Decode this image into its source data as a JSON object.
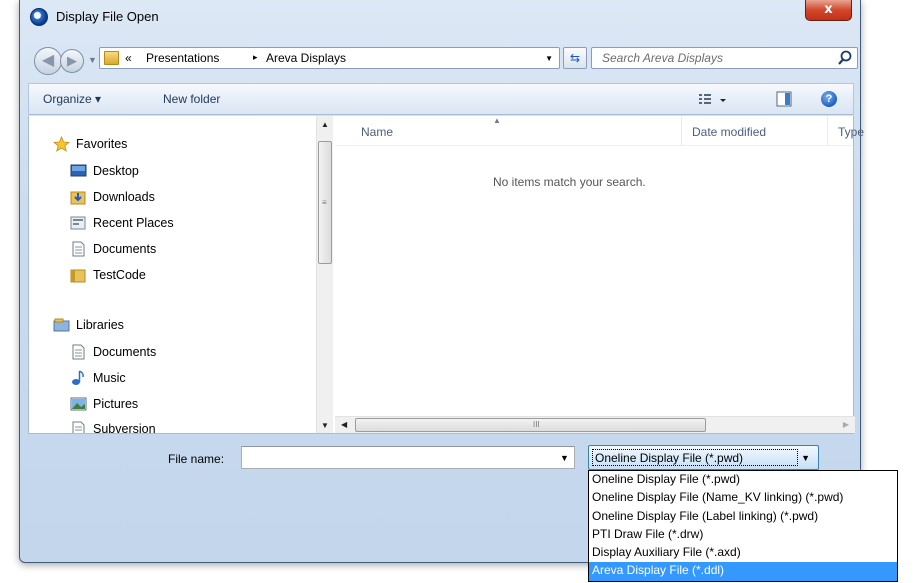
{
  "window": {
    "title": "Display File Open",
    "close_glyph": "x"
  },
  "navigation": {
    "back_glyph": "◀",
    "forward_glyph": "▶",
    "breadcrumb": {
      "overflow": "«",
      "items": [
        "Presentations",
        "Areva Displays"
      ],
      "separator": "▸"
    },
    "refresh_glyph": "⇆",
    "search_placeholder": "Search Areva Displays"
  },
  "toolbar": {
    "organize_label": "Organize ▾",
    "new_folder_label": "New folder",
    "help_glyph": "?"
  },
  "sidebar": {
    "favorites_label": "Favorites",
    "favorites": [
      "Desktop",
      "Downloads",
      "Recent Places",
      "Documents",
      "TestCode"
    ],
    "libraries_label": "Libraries",
    "libraries": [
      "Documents",
      "Music",
      "Pictures",
      "Subversion"
    ]
  },
  "file_list": {
    "columns": [
      "Name",
      "Date modified",
      "Type"
    ],
    "empty_message": "No items match your search.",
    "hscroll_grip": "III"
  },
  "file_name": {
    "label": "File name:",
    "value": ""
  },
  "file_type": {
    "selected": "Oneline Display File (*.pwd)",
    "options": [
      "Oneline Display File (*.pwd)",
      "Oneline Display File (Name_KV linking) (*.pwd)",
      "Oneline Display File (Label linking) (*.pwd)",
      "PTI Draw File (*.drw)",
      "Display Auxiliary File (*.axd)",
      "Areva Display File (*.ddl)"
    ],
    "highlighted_index": 5
  },
  "colors": {
    "selection": "#3399ff",
    "close_button": "#c0301a",
    "frame": "#c9dbef"
  }
}
